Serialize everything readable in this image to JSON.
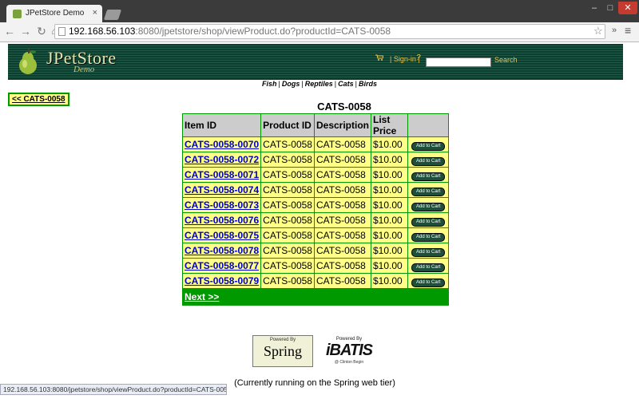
{
  "browser": {
    "tab_title": "JPetStore Demo",
    "tab_close": "×",
    "url_host": "192.168.56.103",
    "url_rest": ":8080/jpetstore/shop/viewProduct.do?productId=CATS-0058",
    "status_url": "192.168.56.103:8080/jpetstore/shop/viewProduct.do?productId=CATS-0058",
    "window_buttons": {
      "minimize": "–",
      "maximize": "□",
      "close": "✕"
    },
    "nav": {
      "back": "←",
      "forward": "→",
      "reload": "↻",
      "home": "⌂"
    },
    "star": "☆",
    "more": "»",
    "menu": "≡"
  },
  "header": {
    "brand": "JPetStore",
    "brand_sub": "Demo",
    "signin": "| Sign-in |",
    "help": "?",
    "search_button": "Search",
    "search_value": ""
  },
  "quicklinks": [
    "Fish",
    "Dogs",
    "Reptiles",
    "Cats",
    "Birds"
  ],
  "back_link": "<< CATS-0058",
  "product_title": "CATS-0058",
  "table": {
    "headers": [
      "Item ID",
      "Product ID",
      "Description",
      "List Price",
      ""
    ],
    "add_label": "Add to Cart",
    "rows": [
      {
        "item": "CATS-0058-0070",
        "product": "CATS-0058",
        "desc": "CATS-0058",
        "price": "$10.00"
      },
      {
        "item": "CATS-0058-0072",
        "product": "CATS-0058",
        "desc": "CATS-0058",
        "price": "$10.00"
      },
      {
        "item": "CATS-0058-0071",
        "product": "CATS-0058",
        "desc": "CATS-0058",
        "price": "$10.00"
      },
      {
        "item": "CATS-0058-0074",
        "product": "CATS-0058",
        "desc": "CATS-0058",
        "price": "$10.00"
      },
      {
        "item": "CATS-0058-0073",
        "product": "CATS-0058",
        "desc": "CATS-0058",
        "price": "$10.00"
      },
      {
        "item": "CATS-0058-0076",
        "product": "CATS-0058",
        "desc": "CATS-0058",
        "price": "$10.00"
      },
      {
        "item": "CATS-0058-0075",
        "product": "CATS-0058",
        "desc": "CATS-0058",
        "price": "$10.00"
      },
      {
        "item": "CATS-0058-0078",
        "product": "CATS-0058",
        "desc": "CATS-0058",
        "price": "$10.00"
      },
      {
        "item": "CATS-0058-0077",
        "product": "CATS-0058",
        "desc": "CATS-0058",
        "price": "$10.00"
      },
      {
        "item": "CATS-0058-0079",
        "product": "CATS-0058",
        "desc": "CATS-0058",
        "price": "$10.00"
      }
    ],
    "next": "Next >>"
  },
  "footer": {
    "spring_small": "Powered By",
    "spring_big": "Spring",
    "ibatis_small": "Powered By",
    "ibatis_big": "iBATIS",
    "ibatis_tiny": "@ Clinton Begin",
    "running": "(Currently running on the Spring web tier)"
  },
  "colors": {
    "header_bg": "#0c3f2f",
    "table_border": "#009900",
    "cell_bg": "#ffff88",
    "link": "#0000cc"
  }
}
